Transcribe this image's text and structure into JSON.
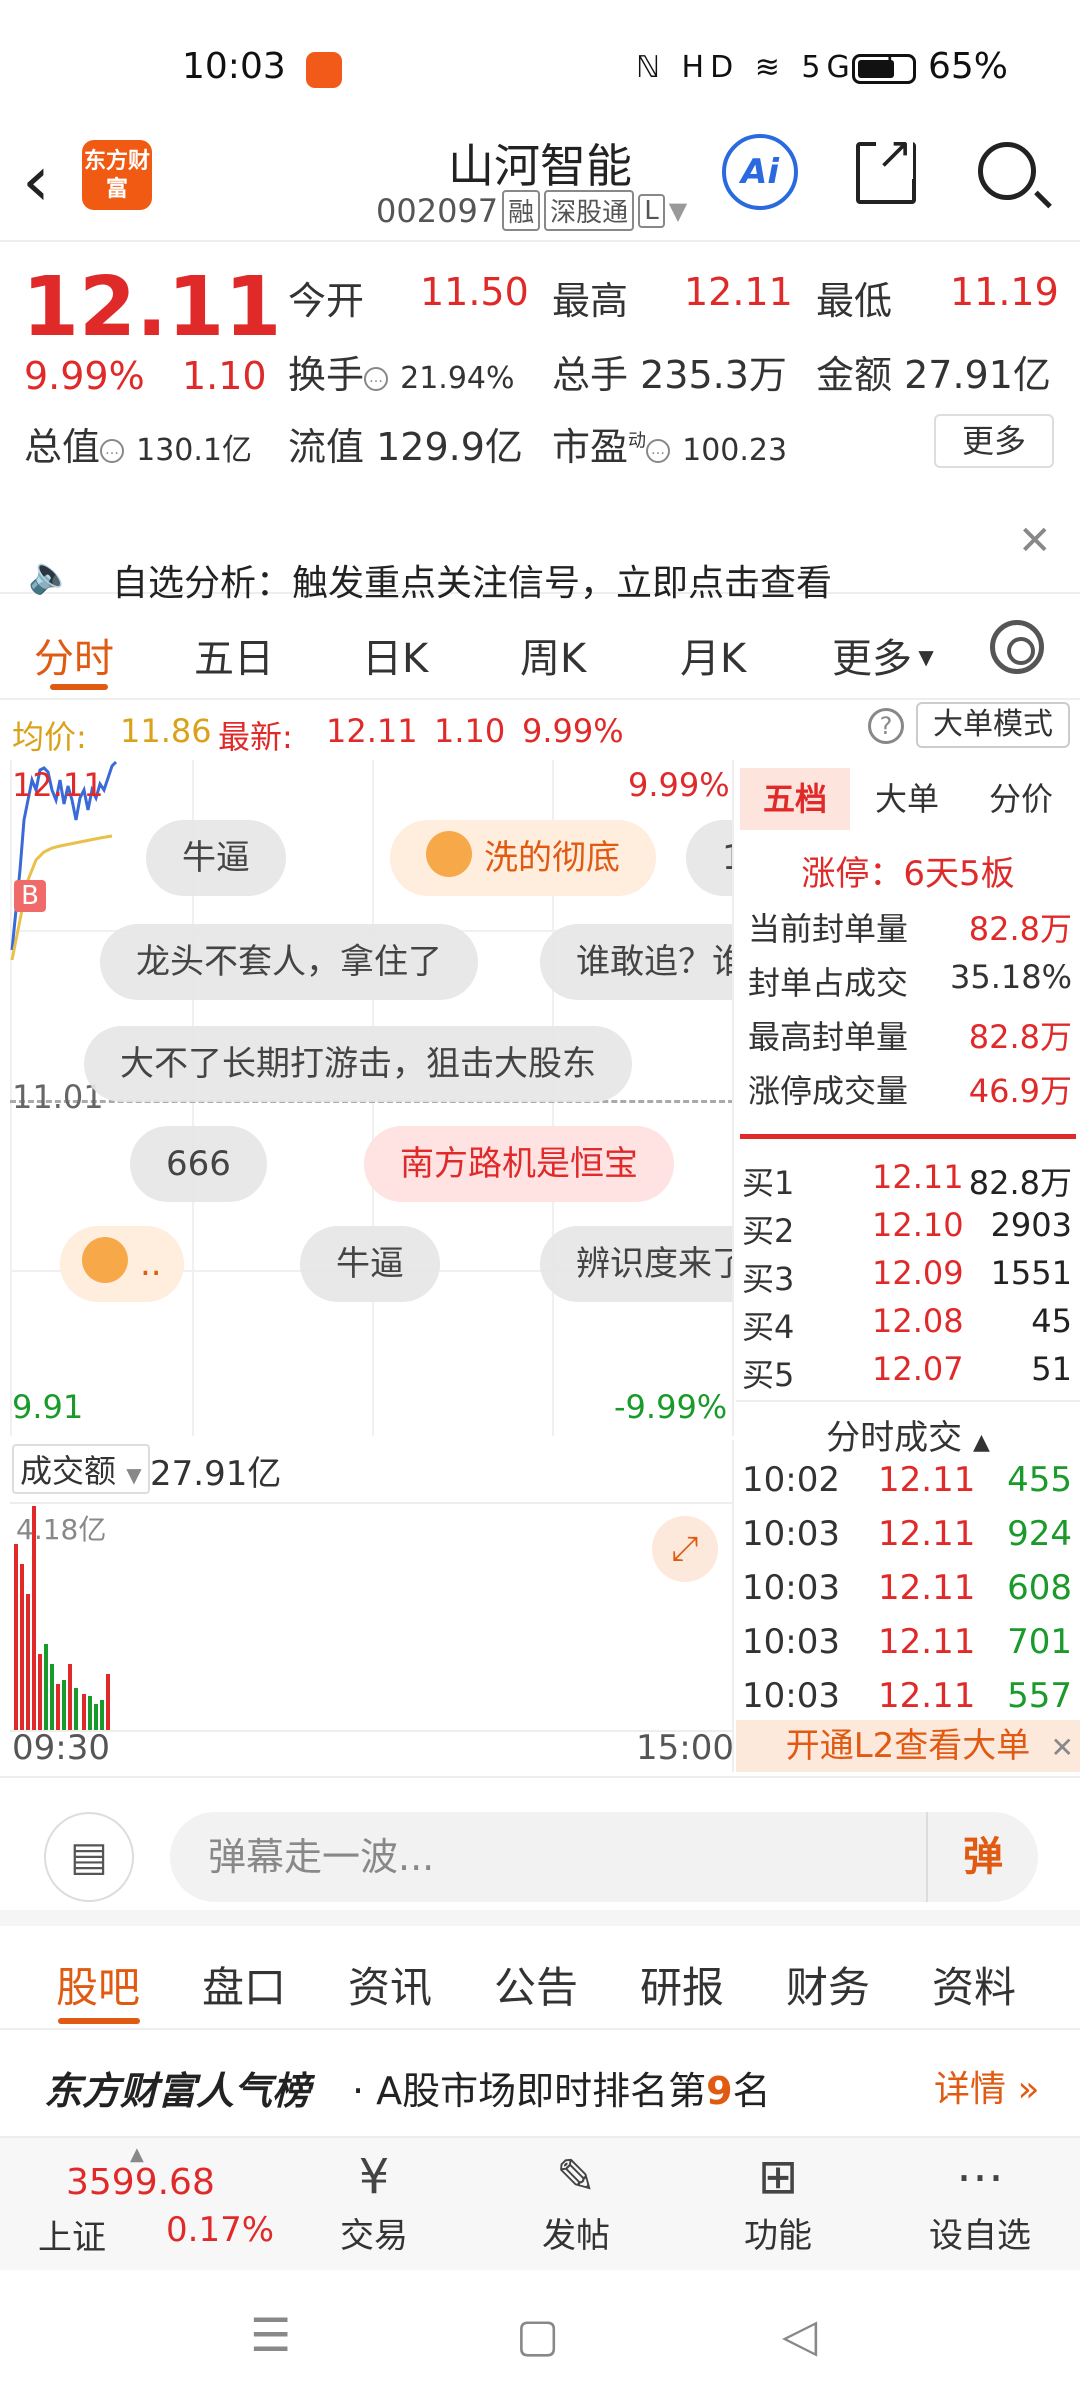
{
  "status": {
    "time": "10:03",
    "icons": "ℕ HD ≋ 5G ıl",
    "battery": "65%"
  },
  "header": {
    "logo": "东方财富",
    "name": "山河智能",
    "code": "002097",
    "tags": [
      "融",
      "深股通",
      "L"
    ],
    "ai": "Ai"
  },
  "quote": {
    "price": "12.11",
    "pct": "9.99%",
    "change": "1.10",
    "open_label": "今开",
    "open": "11.50",
    "high_label": "最高",
    "high": "12.11",
    "low_label": "最低",
    "low": "11.19",
    "turnover_label": "换手",
    "turnover": "21.94%",
    "volume_label": "总手",
    "volume": "235.3万",
    "amount_label": "金额",
    "amount": "27.91亿",
    "mktcap_label": "总值",
    "mktcap": "130.1亿",
    "float_label": "流值",
    "float": "129.9亿",
    "pe_label": "市盈",
    "pe_sup": "动",
    "pe": "100.23",
    "more": "更多"
  },
  "banner": {
    "text": "自选分析：触发重点关注信号，立即点击查看"
  },
  "tabs": [
    "分时",
    "五日",
    "日K",
    "周K",
    "月K",
    "更多"
  ],
  "avgline": {
    "avg_label": "均价:",
    "avg": "11.86",
    "latest_label": "最新:",
    "latest": "12.11",
    "chg": "1.10",
    "pct": "9.99%",
    "mode": "大单模式"
  },
  "chart": {
    "top_left": "12.11",
    "top_right": "9.99%",
    "mid": "11.01",
    "bottom_left": "9.91",
    "bottom_right": "-9.99%",
    "b_marker": "B",
    "bullets": [
      "牛逼",
      "洗的彻底",
      "1",
      "龙头不套人，拿住了",
      "谁敢追？谁",
      "大不了长期打游击，狙击大股东",
      "666",
      "南方路机是恒宝",
      "..",
      "牛逼",
      "辨识度来了"
    ]
  },
  "volume": {
    "selector": "成交额",
    "total": "27.91亿",
    "max": "4.18亿",
    "start": "09:30",
    "end": "15:00"
  },
  "rpanel": {
    "tabs": [
      "五档",
      "大单",
      "分价"
    ],
    "limit_title": "涨停：6天5板",
    "limits": [
      {
        "label": "当前封单量",
        "value": "82.8万"
      },
      {
        "label": "封单占成交",
        "value": "35.18%"
      },
      {
        "label": "最高封单量",
        "value": "82.8万"
      },
      {
        "label": "涨停成交量",
        "value": "46.9万"
      }
    ],
    "bids": [
      {
        "label": "买1",
        "price": "12.11",
        "vol": "82.8万"
      },
      {
        "label": "买2",
        "price": "12.10",
        "vol": "2903"
      },
      {
        "label": "买3",
        "price": "12.09",
        "vol": "1551"
      },
      {
        "label": "买4",
        "price": "12.08",
        "vol": "45"
      },
      {
        "label": "买5",
        "price": "12.07",
        "vol": "51"
      }
    ],
    "ticks_title": "分时成交",
    "ticks": [
      {
        "time": "10:02",
        "price": "12.11",
        "vol": "455"
      },
      {
        "time": "10:03",
        "price": "12.11",
        "vol": "924"
      },
      {
        "time": "10:03",
        "price": "12.11",
        "vol": "608"
      },
      {
        "time": "10:03",
        "price": "12.11",
        "vol": "701"
      },
      {
        "time": "10:03",
        "price": "12.11",
        "vol": "557"
      }
    ],
    "l2": "开通L2查看大单"
  },
  "danmu": {
    "placeholder": "弹幕走一波...",
    "btn": "弹"
  },
  "btabs": [
    "股吧",
    "盘口",
    "资讯",
    "公告",
    "研报",
    "财务",
    "资料"
  ],
  "popularity": {
    "title": "东方财富人气榜",
    "prefix": "· A股市场即时排名第",
    "rank": "9",
    "suffix": "名",
    "detail": "详情 »"
  },
  "toolbar": {
    "index_value": "3599.68",
    "index_name": "上证",
    "index_pct": "0.17%",
    "items": [
      {
        "label": "交易",
        "icon": "¥"
      },
      {
        "label": "发帖",
        "icon": "✎"
      },
      {
        "label": "功能",
        "icon": "⊞"
      },
      {
        "label": "设自选",
        "icon": "⋯"
      }
    ]
  }
}
